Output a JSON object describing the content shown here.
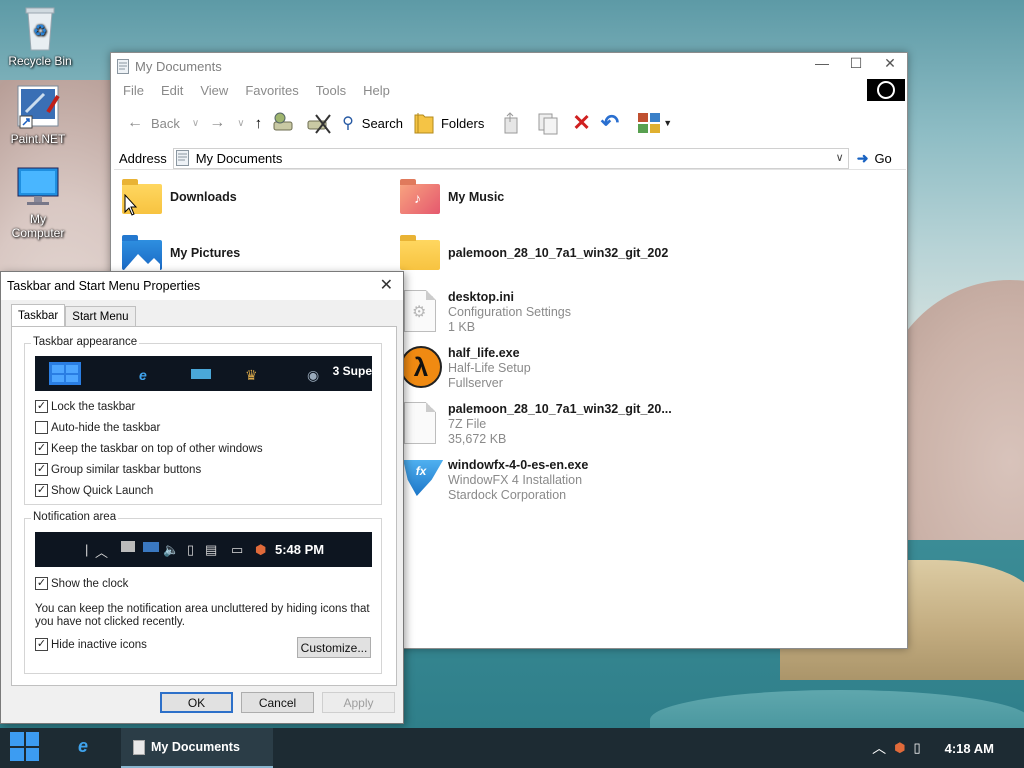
{
  "desktop": {
    "icons": [
      {
        "label": "Recycle Bin",
        "icon": "recycle-bin-icon"
      },
      {
        "label": "Paint.NET",
        "icon": "paint-net-icon"
      },
      {
        "label": "My Computer",
        "icon": "computer-icon"
      }
    ]
  },
  "explorer": {
    "title": "My Documents",
    "menu": [
      "File",
      "Edit",
      "View",
      "Favorites",
      "Tools",
      "Help"
    ],
    "toolbar": {
      "back_label": "Back",
      "search_label": "Search",
      "folders_label": "Folders"
    },
    "address": {
      "label": "Address",
      "value": "My Documents",
      "go_label": "Go"
    },
    "items": [
      {
        "name": "Downloads",
        "lines": [],
        "icon": "folder-icon"
      },
      {
        "name": "My Music",
        "lines": [],
        "icon": "music-folder-icon"
      },
      {
        "name": "My Pictures",
        "lines": [],
        "icon": "pictures-folder-icon"
      },
      {
        "name": "palemoon_28_10_7a1_win32_git_202",
        "lines": [],
        "icon": "folder-icon"
      },
      {
        "name": "desktop.ini",
        "lines": [
          "Configuration Settings",
          "1 KB"
        ],
        "icon": "settings-file-icon"
      },
      {
        "name": "half_life.exe",
        "lines": [
          "Half-Life Setup",
          "Fullserver"
        ],
        "icon": "half-life-icon"
      },
      {
        "name": "palemoon_28_10_7a1_win32_git_20...",
        "lines": [
          "7Z File",
          "35,672 KB"
        ],
        "icon": "archive-file-icon"
      },
      {
        "name": "windowfx-4-0-es-en.exe",
        "lines": [
          "WindowFX 4 Installation",
          "Stardock Corporation"
        ],
        "icon": "windowfx-icon"
      }
    ]
  },
  "dialog": {
    "title": "Taskbar and Start Menu Properties",
    "tabs": [
      "Taskbar",
      "Start Menu"
    ],
    "taskbar_appearance": {
      "label": "Taskbar appearance",
      "preview_text": "3 Supe",
      "options": [
        {
          "label": "Lock the taskbar",
          "checked": true
        },
        {
          "label": "Auto-hide the taskbar",
          "checked": false
        },
        {
          "label": "Keep the taskbar on top of other windows",
          "checked": true
        },
        {
          "label": "Group similar taskbar buttons",
          "checked": true
        },
        {
          "label": "Show Quick Launch",
          "checked": true
        }
      ]
    },
    "notification_area": {
      "label": "Notification area",
      "preview_time": "5:48 PM",
      "show_clock": {
        "label": "Show the clock",
        "checked": true
      },
      "note": "You can keep the notification area uncluttered by hiding icons that you have not clicked recently.",
      "hide_inactive": {
        "label": "Hide inactive icons",
        "checked": true
      },
      "customize_label": "Customize..."
    },
    "buttons": {
      "ok": "OK",
      "cancel": "Cancel",
      "apply": "Apply"
    }
  },
  "taskbar": {
    "active_task": "My Documents",
    "clock": "4:18 AM"
  }
}
